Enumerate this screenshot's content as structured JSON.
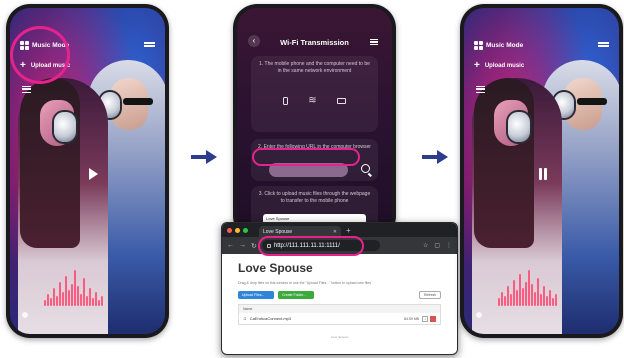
{
  "left_phone": {
    "mode_label": "Music Mode",
    "upload_label": "Upload music",
    "state": "play"
  },
  "right_phone": {
    "mode_label": "Music Mode",
    "upload_label": "Upload music",
    "state": "pause"
  },
  "wifi_phone": {
    "title": "Wi-Fi Transmission",
    "step1": "1. The mobile phone and the computer need to be in the same network environment",
    "step2": "2. Enter the following URL in the computer browser",
    "step3": "3. Click to upload music files through the webpage to transfer to the mobile phone",
    "mini_page_title": "Love Spouse"
  },
  "browser": {
    "tab_title": "Love Spouse",
    "url": "http://111.111.11.11:1111/",
    "page_title": "Love Spouse",
    "hint": "Drag & drop files on this window or use the \"Upload Files...\" button to upload new files",
    "upload_button": "Upload Files...",
    "create_folder_button": "Create Folder...",
    "refresh_button": "Refresh",
    "table_header": "Name",
    "file_name": "CaEroticaConnect.mp3",
    "file_size": "84.59 MB",
    "footer": "Love Spouse"
  },
  "colors": {
    "highlight": "#e6238d",
    "arrow": "#2d3c8c"
  }
}
